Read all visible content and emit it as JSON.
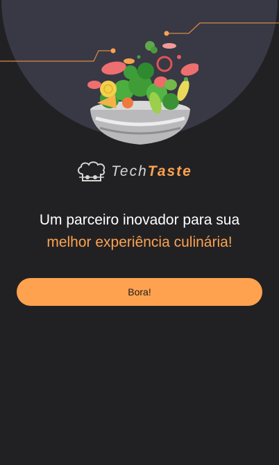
{
  "brand": {
    "name_light": "Tech",
    "name_bold": "Taste",
    "icon": "chef-hat-icon"
  },
  "hero": {
    "illustration": "salad-bowl-illustration"
  },
  "tagline": {
    "line1": "Um parceiro inovador para sua",
    "line2": "melhor experiência culinária!"
  },
  "cta": {
    "label": "Bora!"
  },
  "colors": {
    "background": "#212124",
    "hero_circle": "#393845",
    "accent": "#ffa24f",
    "text": "#ffffff"
  }
}
